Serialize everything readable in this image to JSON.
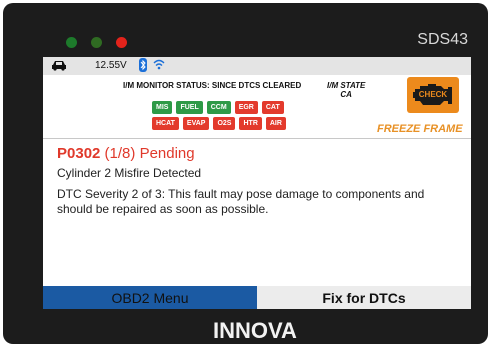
{
  "device": {
    "model": "SDS43",
    "brand": "INNOVA",
    "leds": [
      {
        "name": "led-green-1",
        "color": "#1d7a2b"
      },
      {
        "name": "led-green-2",
        "color": "#2f6b22"
      },
      {
        "name": "led-red",
        "color": "#e3231b"
      }
    ]
  },
  "status_bar": {
    "vehicle_icon": "car-icon",
    "voltage": "12.55V",
    "bluetooth_icon": "bluetooth-icon",
    "wifi_icon": "wifi-icon"
  },
  "im_monitor": {
    "title": "I/M MONITOR STATUS: SINCE DTCS CLEARED",
    "state_label": "I/M STATE",
    "state_value": "CA",
    "row1": [
      {
        "label": "MIS",
        "status": "green"
      },
      {
        "label": "FUEL",
        "status": "green"
      },
      {
        "label": "CCM",
        "status": "green"
      },
      {
        "label": "EGR",
        "status": "red"
      },
      {
        "label": "CAT",
        "status": "red"
      }
    ],
    "row2": [
      {
        "label": "HCAT",
        "status": "red"
      },
      {
        "label": "EVAP",
        "status": "red"
      },
      {
        "label": "O2S",
        "status": "red"
      },
      {
        "label": "HTR",
        "status": "red"
      },
      {
        "label": "AIR",
        "status": "red"
      }
    ]
  },
  "check_engine": {
    "icon": "check-engine-icon",
    "label": "CHECK"
  },
  "freeze_frame": "FREEZE FRAME",
  "dtc": {
    "code": "P0302",
    "position": "(1/8)",
    "status": "Pending",
    "description": "Cylinder 2 Misfire Detected",
    "severity_text": "DTC Severity 2 of 3: This fault may pose damage to components and should be repaired as soon as possible."
  },
  "buttons": {
    "left": "OBD2 Menu",
    "right": "Fix for DTCs"
  },
  "colors": {
    "accent_red": "#e0392b",
    "accent_orange": "#e89126",
    "menu_blue": "#1b5aa3"
  }
}
